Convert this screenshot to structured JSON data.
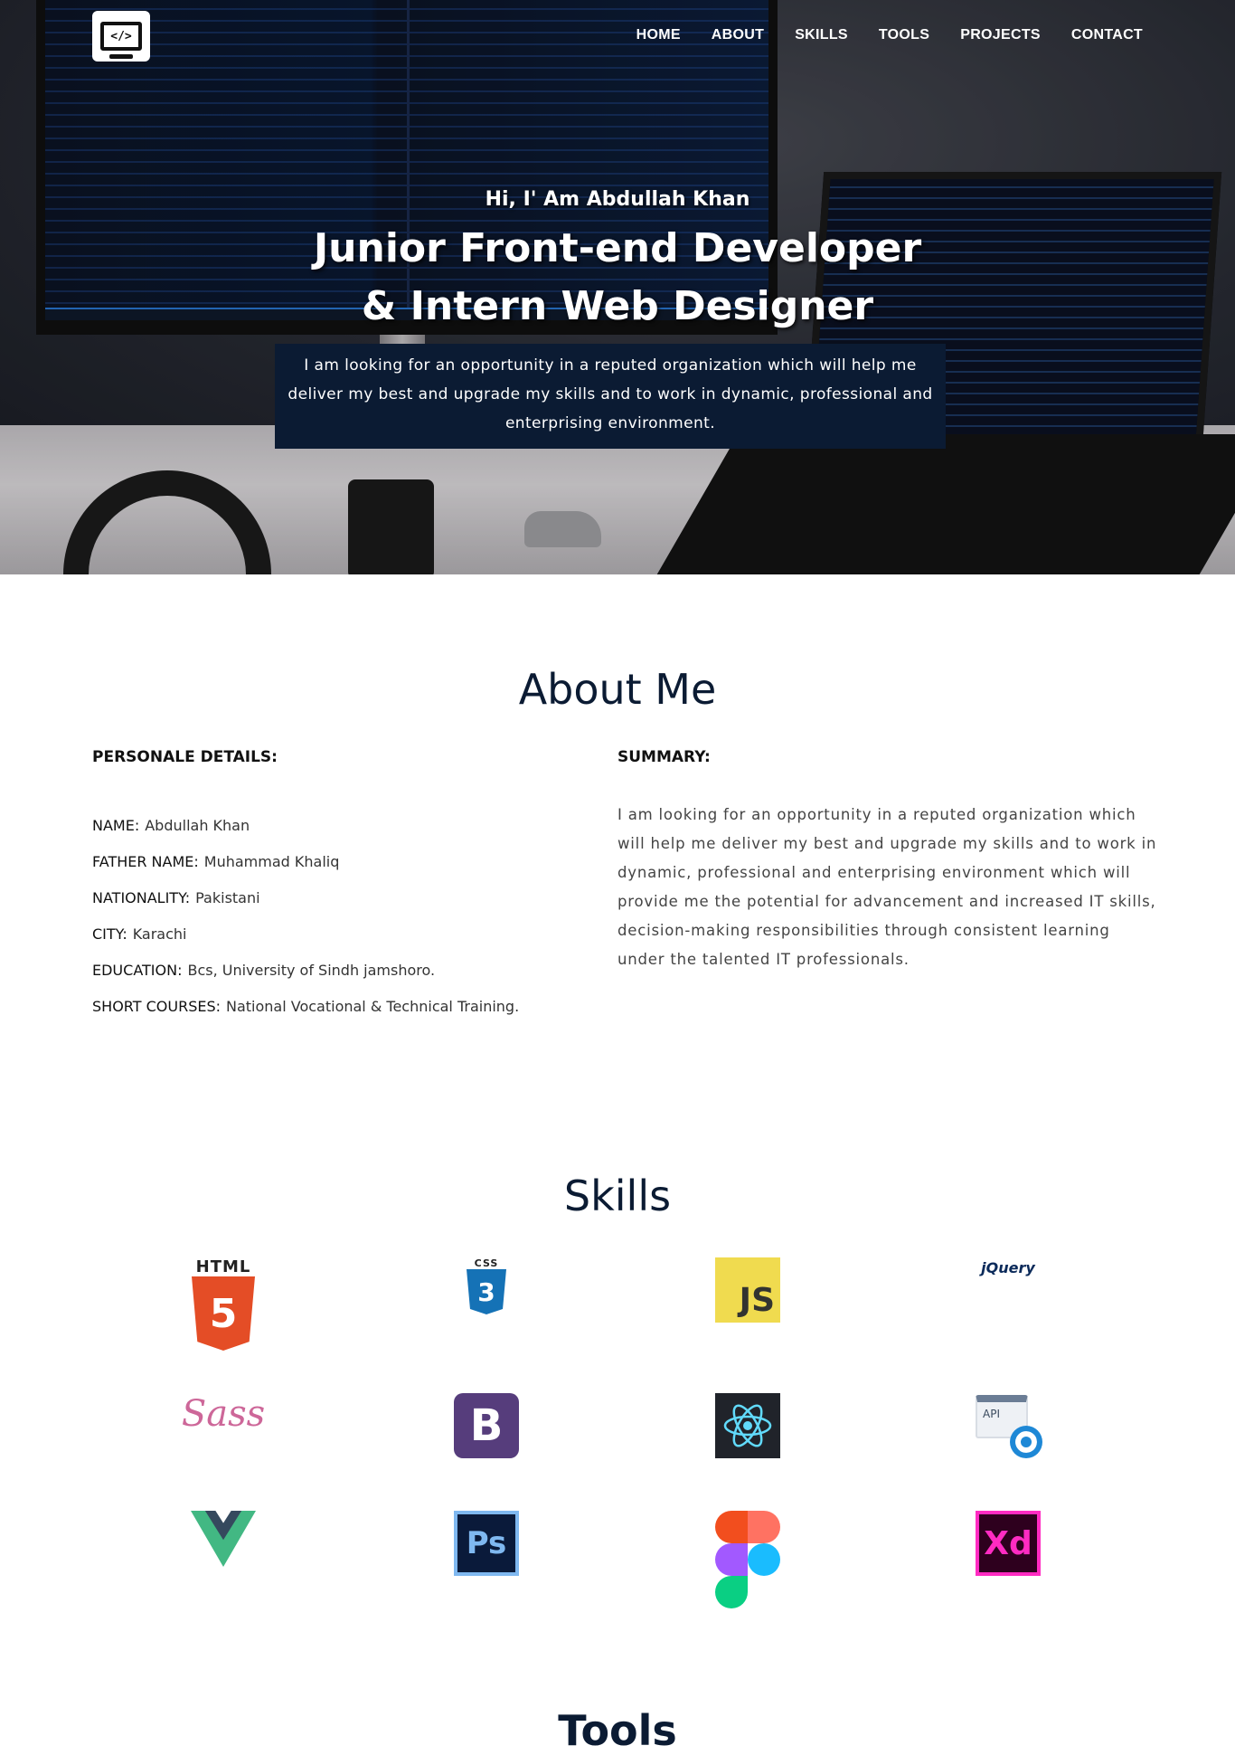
{
  "nav": {
    "logo_glyph": "</>",
    "items": [
      "HOME",
      "ABOUT",
      "SKILLS",
      "TOOLS",
      "PROJECTS",
      "CONTACT"
    ]
  },
  "hero": {
    "greeting": "Hi, I' Am Abdullah Khan",
    "headline_line1": "Junior Front-end Developer",
    "headline_line2": "& Intern Web Designer",
    "intro": "I am looking for an opportunity in a reputed organization which will help me deliver my best and upgrade my skills and to work in dynamic, professional and enterprising environment."
  },
  "about": {
    "title": "About Me",
    "personal_heading": "PERSONALE DETAILS:",
    "summary_heading": "SUMMARY:",
    "details": [
      {
        "key": "NAME:",
        "value": "Abdullah Khan"
      },
      {
        "key": "FATHER NAME:",
        "value": "Muhammad Khaliq"
      },
      {
        "key": "NATIONALITY:",
        "value": "Pakistani"
      },
      {
        "key": "CITY:",
        "value": "Karachi"
      },
      {
        "key": "EDUCATION:",
        "value": "Bcs, University of Sindh jamshoro."
      },
      {
        "key": "SHORT COURSES:",
        "value": "National Vocational & Technical Training."
      }
    ],
    "summary": "I am looking for an opportunity in a reputed organization which will help me deliver my best and upgrade my skills and to work in dynamic, professional and enterprising environment which will provide me the potential for advancement and increased IT skills, decision-making responsibilities through consistent learning under the talented IT professionals."
  },
  "skills": {
    "title": "Skills",
    "html_label": "HTML",
    "html_badge": "5",
    "css_label": "CSS",
    "css_badge": "3",
    "js_label": "JS",
    "jquery_label": "jQuery",
    "sass_label": "Sass",
    "bootstrap_label": "B",
    "api_label": "API",
    "ps_label": "Ps",
    "xd_label": "Xd"
  },
  "tools": {
    "title": "Tools"
  },
  "colors": {
    "navy": "#0b1b33",
    "html": "#e44d26",
    "css": "#1572b6",
    "js": "#f0db4f",
    "bootstrap": "#563d7c",
    "react": "#61dafb",
    "vue_green": "#42b883",
    "xd_pink": "#ff2bc2"
  }
}
